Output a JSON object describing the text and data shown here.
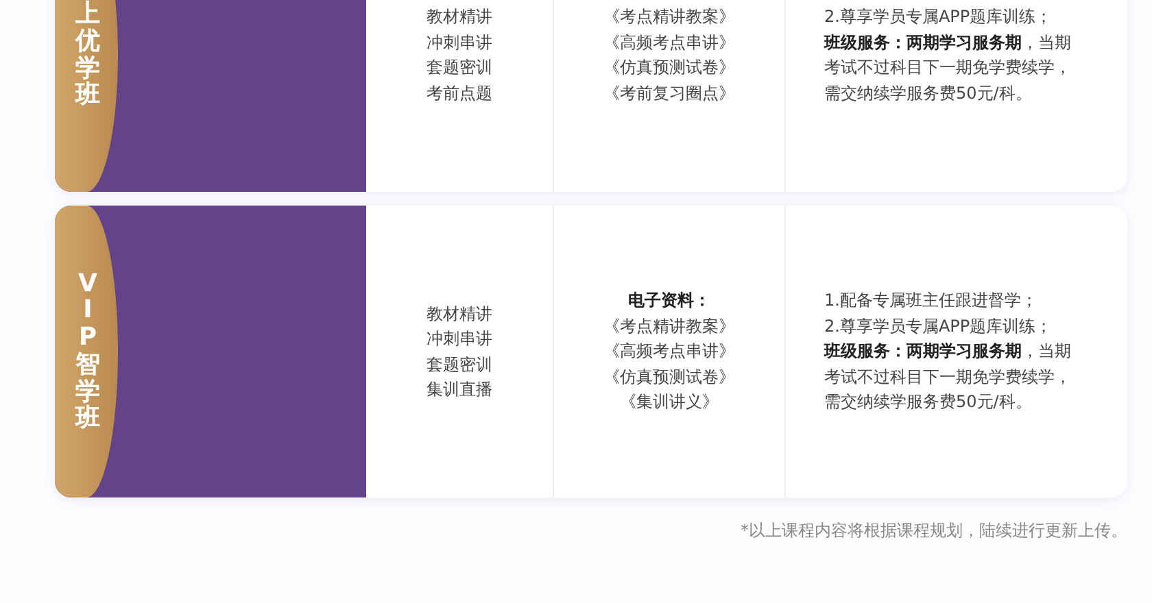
{
  "cards": [
    {
      "label": "上优学班",
      "courses": [
        "教材精讲",
        "冲刺串讲",
        "套题密训",
        "考前点题"
      ],
      "materials": [
        "《考点精讲教案》",
        "《高频考点串讲》",
        "《仿真预测试卷》",
        "《考前复习圈点》"
      ],
      "services": [
        "2.尊享学员专属APP题库训练；",
        "**班级服务：两期学习服务期**，当期考试不过科目下一期免学费续学，需交纳续学服务费50元/科。"
      ]
    },
    {
      "label": "VIP智学班",
      "courses": [
        "教材精讲",
        "冲刺串讲",
        "套题密训",
        "集训直播"
      ],
      "materials_heading": "电子资料：",
      "materials": [
        "《考点精讲教案》",
        "《高频考点串讲》",
        "《仿真预测试卷》",
        "《集训讲义》"
      ],
      "services": [
        "1.配备专属班主任跟进督学；",
        "2.尊享学员专属APP题库训练；",
        "**班级服务：两期学习服务期**，当期考试不过科目下一期免学费续学，需交纳续学服务费50元/科。"
      ]
    }
  ],
  "footnote": "*以上课程内容将根据课程规划，陆续进行更新上传。"
}
